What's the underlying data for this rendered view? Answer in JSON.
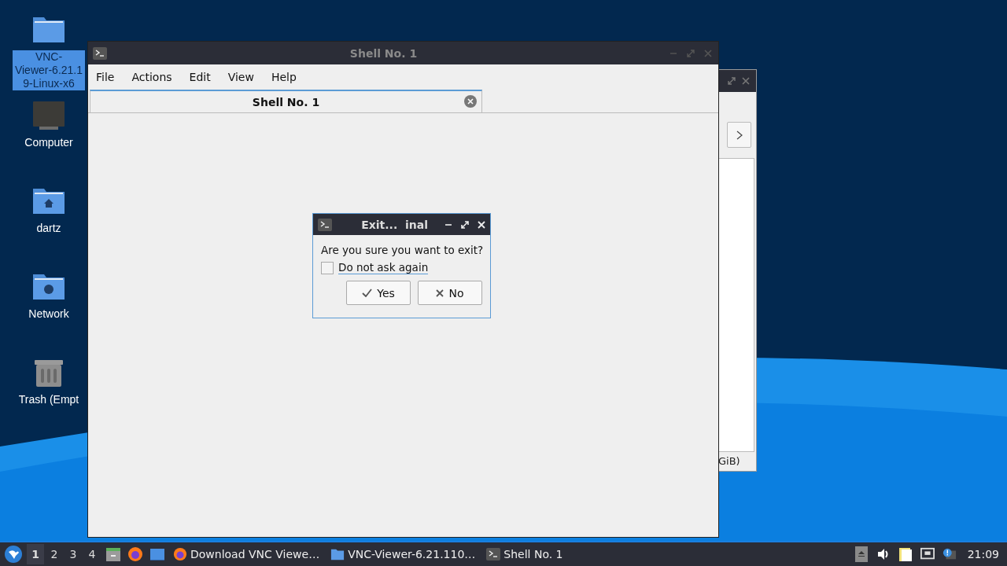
{
  "desktop_icons": [
    {
      "kind": "folder",
      "label_lines": [
        "VNC-",
        "Viewer-6.21.1",
        "9-Linux-x6"
      ],
      "selected": true
    },
    {
      "kind": "computer",
      "label_lines": [
        "Computer"
      ],
      "selected": false
    },
    {
      "kind": "home",
      "label_lines": [
        "dartz"
      ],
      "selected": false
    },
    {
      "kind": "network",
      "label_lines": [
        "Network"
      ],
      "selected": false
    },
    {
      "kind": "trash",
      "label_lines": [
        "Trash (Empt"
      ],
      "selected": false
    }
  ],
  "back_window": {
    "status_text": "GiB)"
  },
  "shell_window": {
    "title": "Shell No. 1",
    "menu": [
      "File",
      "Actions",
      "Edit",
      "View",
      "Help"
    ],
    "tabs": [
      {
        "label": "Shell No. 1",
        "selected": true
      }
    ]
  },
  "dialog": {
    "title": "Exit...  inal",
    "message": "Are you sure you want to exit?",
    "checkbox": {
      "label": "Do not ask again",
      "checked": false
    },
    "buttons": [
      {
        "kind": "yes",
        "label": "Yes"
      },
      {
        "kind": "no",
        "label": "No"
      }
    ]
  },
  "taskbar": {
    "workspaces": [
      {
        "label": "1",
        "selected": true
      },
      {
        "label": "2",
        "selected": false
      },
      {
        "label": "3",
        "selected": false
      },
      {
        "label": "4",
        "selected": false
      }
    ],
    "tasks": [
      {
        "kind": "browser",
        "label": "Download VNC Viewe…"
      },
      {
        "kind": "folder",
        "label": "VNC-Viewer-6.21.110…"
      },
      {
        "kind": "terminal",
        "label": "Shell No. 1"
      }
    ],
    "clock": "21:09"
  }
}
